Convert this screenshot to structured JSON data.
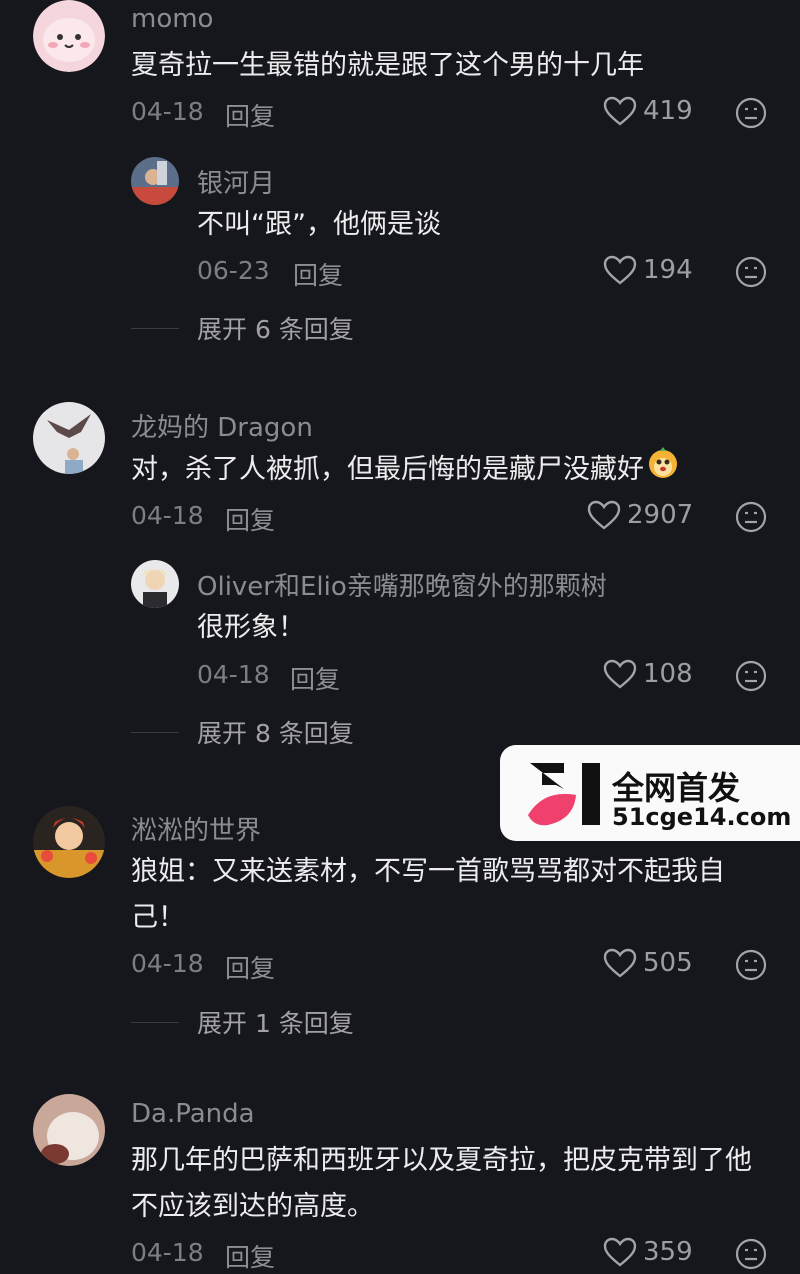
{
  "comments": [
    {
      "username": "momo",
      "text": "夏奇拉一生最错的就是跟了这个男的十几年",
      "date": "04-18",
      "reply_label": "回复",
      "likes": "419",
      "avatar_icon": "pink-bunny-avatar",
      "replies": [
        {
          "username": "银河月",
          "text": "不叫“跟”，他俩是谈",
          "date": "06-23",
          "reply_label": "回复",
          "likes": "194",
          "avatar_icon": "photo-avatar"
        }
      ],
      "expand_label": "展开 6 条回复"
    },
    {
      "username": "龙妈的 Dragon",
      "text": "对，杀了人被抓，但最后悔的是藏尸没藏好",
      "emoji_icon": "yellow-face-emoji",
      "date": "04-18",
      "reply_label": "回复",
      "likes": "2907",
      "avatar_icon": "dragon-photo-avatar",
      "replies": [
        {
          "username": "Oliver和Elio亲嘴那晚窗外的那颗树",
          "text": "很形象！",
          "date": "04-18",
          "reply_label": "回复",
          "likes": "108",
          "avatar_icon": "person-photo-avatar"
        }
      ],
      "expand_label": "展开 8 条回复"
    },
    {
      "username": "淞淞的世界",
      "text": "狼姐：又来送素材，不写一首歌骂骂都对不起我自己！",
      "date": "04-18",
      "reply_label": "回复",
      "likes": "505",
      "avatar_icon": "festive-cartoon-avatar",
      "expand_label": "展开 1 条回复"
    },
    {
      "username": "Da.Panda",
      "text": "那几年的巴萨和西班牙以及夏奇拉，把皮克带到了他不应该到达的高度。",
      "date": "04-18",
      "reply_label": "回复",
      "likes": "359",
      "avatar_icon": "panda-photo-avatar"
    }
  ],
  "watermark": {
    "title": "全网首发",
    "url": "51cge14.com",
    "logo_text": "51"
  },
  "colors": {
    "background": "#16171c",
    "text": "#ececef",
    "muted": "#8b8b92",
    "accent": "#f0406e"
  }
}
